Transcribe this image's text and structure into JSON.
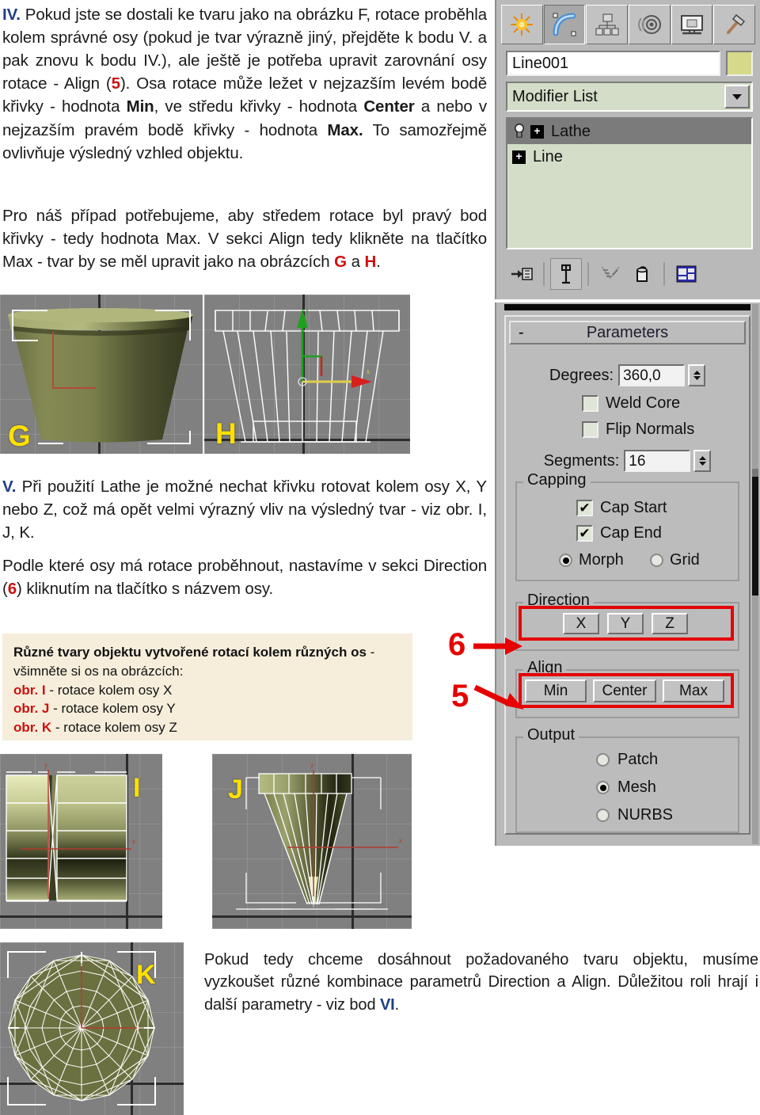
{
  "document": {
    "para1": {
      "marker": "IV.",
      "text_a": " Pokud jste se dostali ke tvaru jako na obrázku F, rotace proběhla kolem správné osy (pokud je tvar výrazně jiný, přejděte k bodu V. a pak znovu k bodu IV.), ale ještě je potřeba upravit zarovnání osy rotace - Align (",
      "ref5": "5",
      "text_b": "). Osa rotace může ležet v nejzazším levém bodě křivky - hodnota ",
      "bold_min": "Min",
      "text_c": ", ve středu křivky - hodnota ",
      "bold_center": "Center",
      "text_d": " a nebo v nejzazším pravém bodě křivky - hodnota ",
      "bold_max": "Max.",
      "text_e": " To samozřejmě ovlivňuje výsledný vzhled objektu."
    },
    "para2": {
      "text_a": "Pro náš případ potřebujeme, aby středem rotace byl pravý bod křivky - tedy hodnota Max. V sekci Align tedy klikněte na tlačítko Max - tvar by se měl upravit jako na obrázcích ",
      "refG": "G",
      "text_b": " a ",
      "refH": "H",
      "text_c": "."
    },
    "para3": {
      "marker": "V.",
      "text": " Při použití Lathe je možné nechat křivku rotovat kolem osy X, Y nebo Z, což má opět velmi výrazný vliv na výsledný tvar - viz obr. I, J, K."
    },
    "para4": {
      "text_a": "Podle které osy má rotace proběhnout, nastavíme v sekci Direction (",
      "ref6": "6",
      "text_b": ") kliknutím na tlačítko s názvem osy."
    },
    "para5": {
      "text_a": "Pokud tedy chceme dosáhnout požadovaného tvaru objektu, musíme vyzkoušet různé kombinace parametrů Direction a Align. Důležitou roli hrají i další parametry - viz bod ",
      "refVI": "VI",
      "text_b": "."
    }
  },
  "notebox": {
    "bold_head": "Různé tvary objektu vytvořené rotací kolem různých os",
    "head_tail": " - všimněte si os na obrázcích:",
    "lines": [
      {
        "ref": "obr. I",
        "text": " - rotace kolem osy X"
      },
      {
        "ref": "obr. J",
        "text": " - rotace kolem osy Y"
      },
      {
        "ref": "obr. K",
        "text": " - rotace kolem osy Z"
      }
    ],
    "bg_color": "#f6eedb",
    "ref_color": "#cc1111"
  },
  "figures": [
    {
      "label": "G",
      "caption_hint": "shaded lathe object - front perspective"
    },
    {
      "label": "H",
      "caption_hint": "wireframe lathe object with gizmo"
    },
    {
      "label": "I",
      "caption_hint": "rotation about X axis"
    },
    {
      "label": "J",
      "caption_hint": "rotation about Y axis"
    },
    {
      "label": "K",
      "caption_hint": "rotation about Z axis - top view"
    }
  ],
  "command_panel": {
    "tabs": [
      {
        "name": "create-tab",
        "icon": "star-icon",
        "selected": false
      },
      {
        "name": "modify-tab",
        "icon": "curve-icon",
        "selected": true
      },
      {
        "name": "hierarchy-tab",
        "icon": "hierarchy-icon",
        "selected": false
      },
      {
        "name": "motion-tab",
        "icon": "motion-icon",
        "selected": false
      },
      {
        "name": "display-tab",
        "icon": "display-icon",
        "selected": false
      },
      {
        "name": "utilities-tab",
        "icon": "hammer-icon",
        "selected": false
      }
    ],
    "object_name": "Line001",
    "object_color": "#d5d98a",
    "modifier_list_label": "Modifier List",
    "modifier_stack": [
      {
        "label": "Lathe",
        "selected": true,
        "has_light_bulb": true
      },
      {
        "label": "Line",
        "selected": false,
        "has_light_bulb": false
      }
    ],
    "stack_tools": [
      "pin-stack-icon",
      "show-end-result-icon",
      "make-unique-icon",
      "remove-modifier-icon",
      "configure-modifier-sets-icon"
    ]
  },
  "parameters": {
    "rollout_title": "Parameters",
    "collapse_glyph": "-",
    "degrees_label": "Degrees:",
    "degrees_value": "360,0",
    "weld_core_label": "Weld Core",
    "weld_core_checked": false,
    "flip_normals_label": "Flip Normals",
    "flip_normals_checked": false,
    "segments_label": "Segments:",
    "segments_value": "16",
    "capping": {
      "title": "Capping",
      "cap_start_label": "Cap Start",
      "cap_start_checked": true,
      "cap_end_label": "Cap End",
      "cap_end_checked": true,
      "morph_label": "Morph",
      "grid_label": "Grid",
      "selected_mode": "Morph"
    },
    "direction": {
      "title": "Direction",
      "buttons": [
        "X",
        "Y",
        "Z"
      ],
      "highlighted": true
    },
    "align": {
      "title": "Align",
      "buttons": [
        "Min",
        "Center",
        "Max"
      ],
      "highlighted": true
    },
    "output": {
      "title": "Output",
      "options": [
        "Patch",
        "Mesh",
        "NURBS"
      ],
      "selected": "Mesh"
    }
  },
  "annotations": [
    {
      "number": "6",
      "target": "direction-group"
    },
    {
      "number": "5",
      "target": "align-group"
    }
  ],
  "colors": {
    "panel_gray": "#b9b9b9",
    "button_gray": "#c2c2c2",
    "stack_green": "#d3ddc8",
    "annotation_red": "#e60000",
    "viewport_gray": "#808080",
    "figure_label_yellow": "#ffe000",
    "heading_blue": "#1f3f82"
  }
}
